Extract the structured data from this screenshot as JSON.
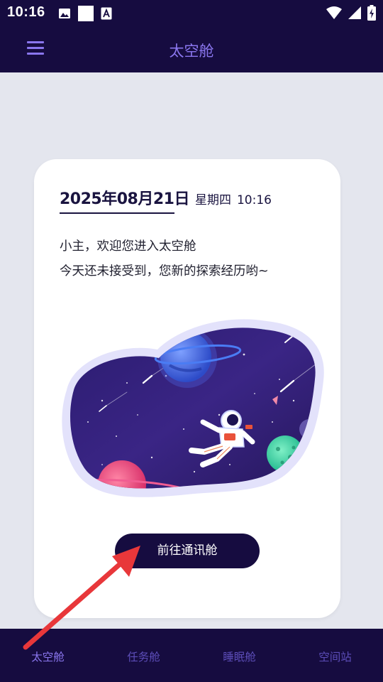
{
  "status_bar": {
    "time": "10:16",
    "icons_left": [
      "image-icon",
      "blank-square-icon",
      "font-a-icon"
    ],
    "icons_right": [
      "wifi-icon",
      "signal-icon",
      "battery-charging-icon"
    ]
  },
  "app_bar": {
    "title": "太空舱",
    "menu_icon": "menu-icon"
  },
  "card": {
    "date": "2025年08月21日",
    "weekday": "星期四",
    "time": "10:16",
    "greeting_line1": "小主，欢迎您进入太空舱",
    "greeting_line2": "今天还未接受到，您新的探索经历哟~",
    "button_label": "前往通讯舱"
  },
  "bottom_nav": {
    "items": [
      {
        "label": "太空舱",
        "active": true
      },
      {
        "label": "任务舱",
        "active": false
      },
      {
        "label": "睡眠舱",
        "active": false
      },
      {
        "label": "空间站",
        "active": false
      }
    ]
  },
  "colors": {
    "primary_dark": "#160c40",
    "accent": "#8a76ee",
    "inactive_nav": "#5c4db8",
    "background": "#e4e6ee",
    "annotation_arrow": "#e8373a"
  }
}
